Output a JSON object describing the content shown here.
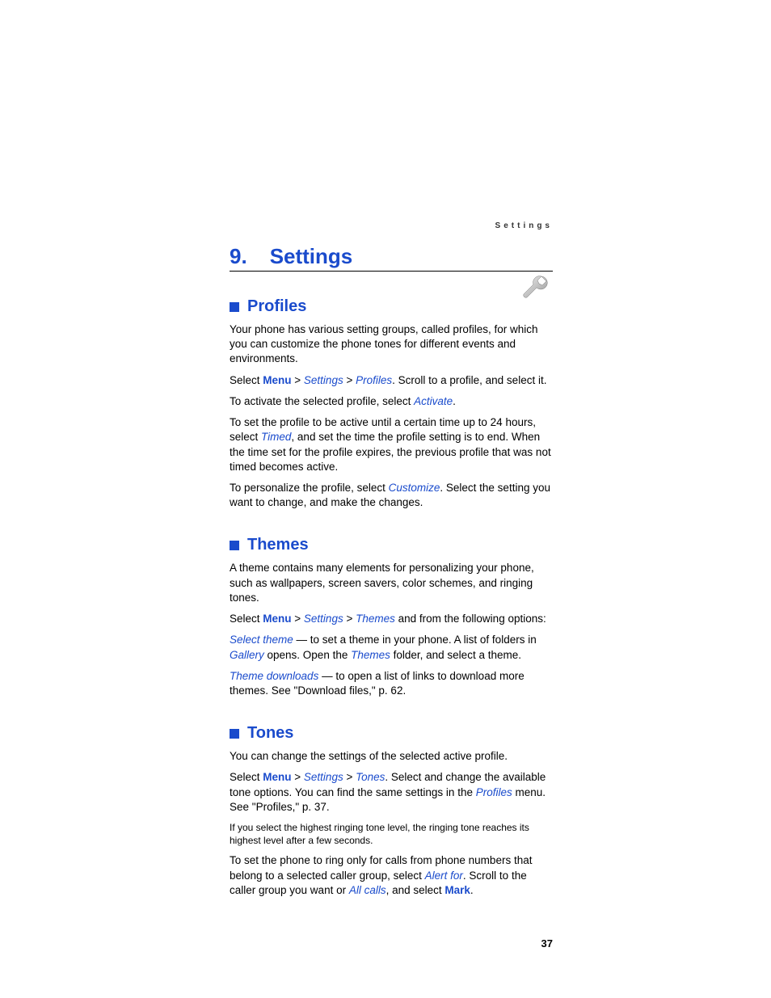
{
  "runningHeader": "Settings",
  "chapterNumber": "9.",
  "chapterTitle": "Settings",
  "pageNumber": "37",
  "sections": {
    "profiles": {
      "title": "Profiles",
      "p1": "Your phone has various setting groups, called profiles, for which you can customize the phone tones for different events and environments.",
      "p2a": "Select ",
      "menu": "Menu",
      "gt": " > ",
      "settings": "Settings",
      "profiles": "Profiles",
      "p2b": ". Scroll to a profile, and select it.",
      "p3a": "To activate the selected profile, select ",
      "activate": "Activate",
      "p3b": ".",
      "p4a": "To set the profile to be active until a certain time up to 24 hours, select ",
      "timed": "Timed",
      "p4b": ", and set the time the profile setting is to end. When the time set for the profile expires, the previous profile that was not timed becomes active.",
      "p5a": "To personalize the profile, select ",
      "customize": "Customize",
      "p5b": ". Select the setting you want to change, and make the changes."
    },
    "themes": {
      "title": "Themes",
      "p1": "A theme contains many elements for personalizing your phone, such as wallpapers, screen savers, color schemes, and ringing tones.",
      "p2a": "Select ",
      "menu": "Menu",
      "gt": " > ",
      "settings": "Settings",
      "themes": "Themes",
      "p2b": " and from the following options:",
      "selectTheme": "Select theme",
      "p3a": " — to set a theme in your phone. A list of folders in ",
      "gallery": "Gallery",
      "p3b": " opens. Open the ",
      "themesFolder": "Themes",
      "p3c": " folder, and select a theme.",
      "themeDownloads": "Theme downloads",
      "p4a": " — to open a list of links to download more themes. See \"Download files,\" p. 62."
    },
    "tones": {
      "title": "Tones",
      "p1": "You can change the settings of the selected active profile.",
      "p2a": "Select ",
      "menu": "Menu",
      "gt": " > ",
      "settings": "Settings",
      "tones": "Tones",
      "p2b": ". Select and change the available tone options. You can find the same settings in the ",
      "profiles": "Profiles",
      "p2c": " menu. See \"Profiles,\" p. 37.",
      "note": "If you select the highest ringing tone level, the ringing tone reaches its highest level after a few seconds.",
      "p3a": "To set the phone to ring only for calls from phone numbers that belong to a selected caller group, select ",
      "alertFor": "Alert for",
      "p3b": ". Scroll to the caller group you want or ",
      "allCalls": "All calls",
      "p3c": ", and select ",
      "mark": "Mark",
      "p3d": "."
    }
  }
}
